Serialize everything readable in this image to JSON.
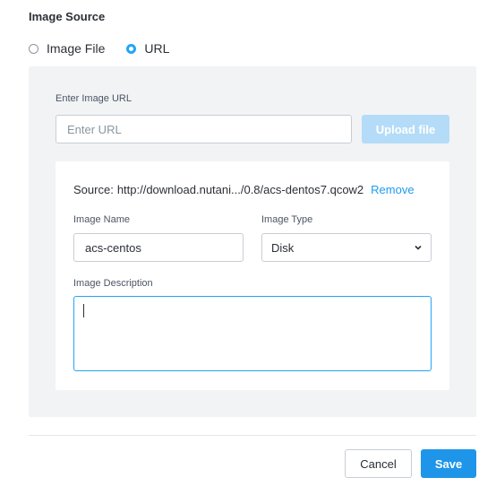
{
  "image_source": {
    "title": "Image Source",
    "options": [
      {
        "label": "Image File",
        "selected": false
      },
      {
        "label": "URL",
        "selected": true
      }
    ]
  },
  "url_section": {
    "label": "Enter Image URL",
    "placeholder": "Enter URL",
    "upload_label": "Upload file"
  },
  "details": {
    "source_prefix": "Source:",
    "source_value": "http://download.nutani.../0.8/acs-dentos7.qcow2",
    "remove_label": "Remove",
    "name_label": "Image Name",
    "name_value": "acs-centos",
    "type_label": "Image Type",
    "type_value": "Disk",
    "description_label": "Image Description",
    "description_value": ""
  },
  "footer": {
    "cancel_label": "Cancel",
    "save_label": "Save"
  },
  "colors": {
    "accent": "#22a5f7",
    "primary_button": "#1e95e8",
    "upload_button_disabled": "#b4dcf8",
    "panel_background": "#f1f3f5"
  },
  "icons": {
    "dropdown": "chevron-down-icon"
  }
}
